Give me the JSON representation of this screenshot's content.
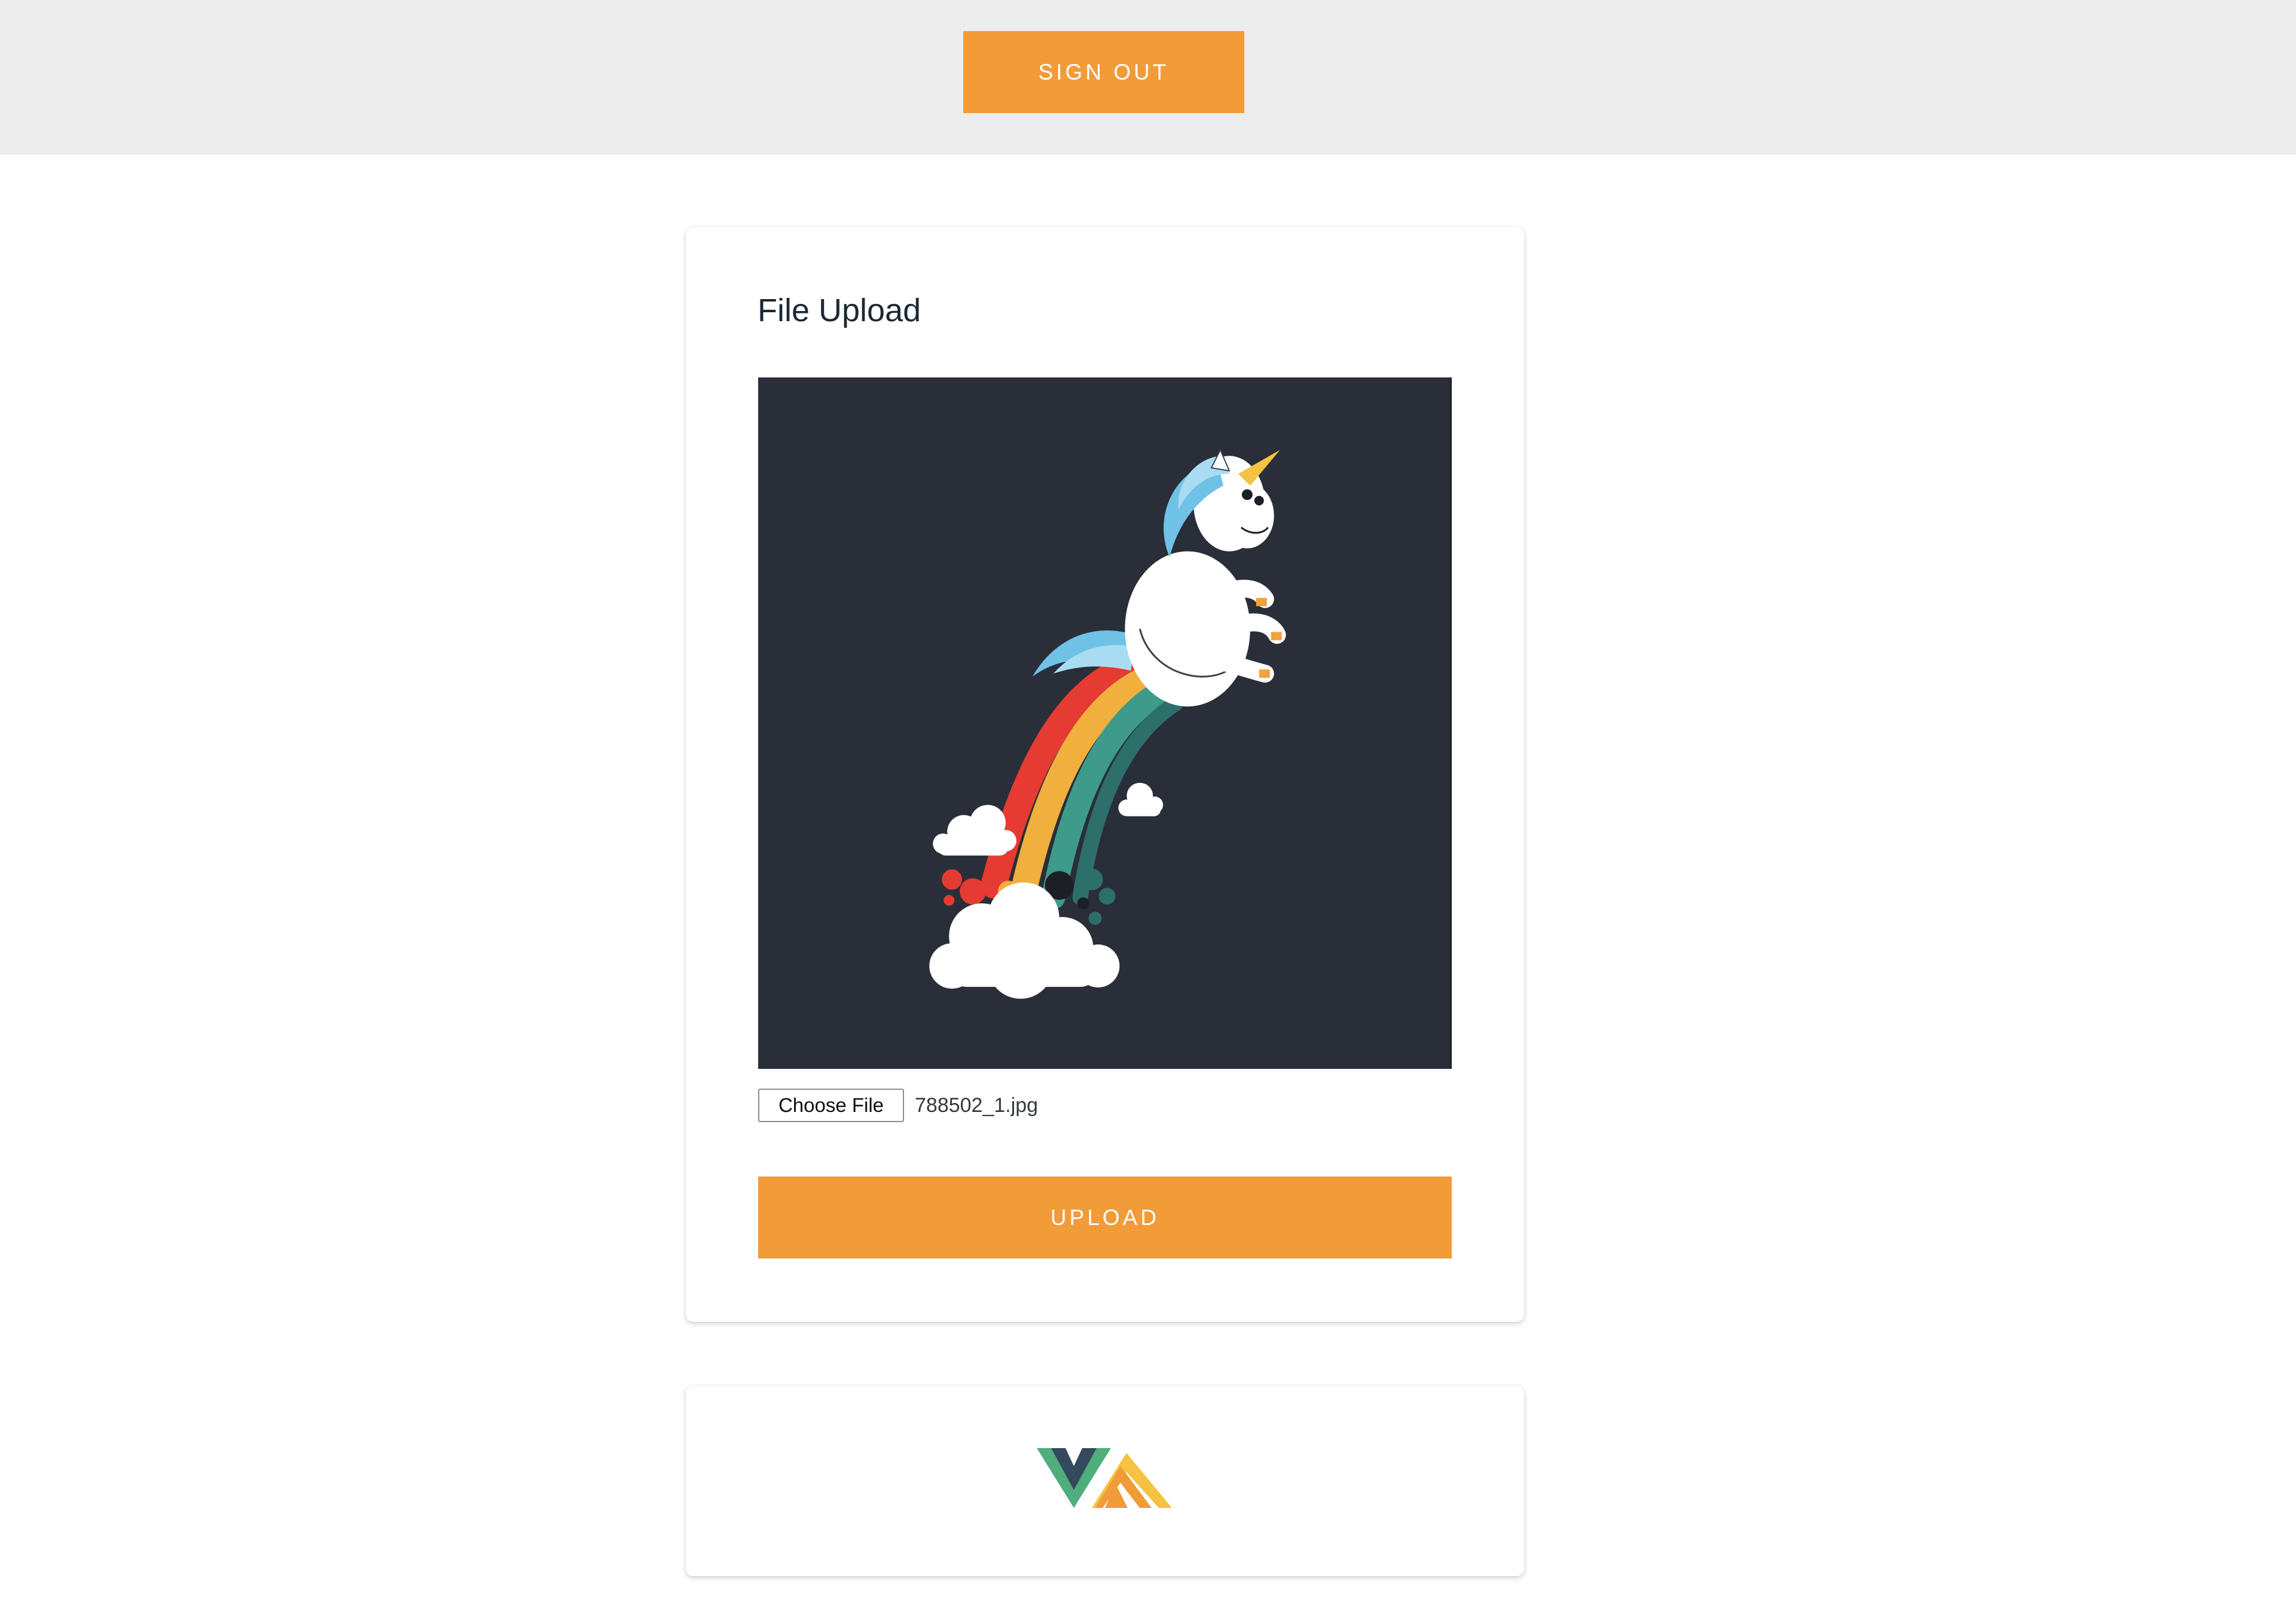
{
  "header": {
    "sign_out_label": "SIGN OUT"
  },
  "upload_card": {
    "title": "File Upload",
    "preview_image": "unicorn-rainbow-illustration",
    "choose_file_label": "Choose File",
    "selected_file_name": "788502_1.jpg",
    "upload_label": "UPLOAD"
  },
  "footer_card": {
    "logo": "vue-amplify-logo"
  },
  "colors": {
    "accent": "#f19b39",
    "topbar_bg": "#ededed",
    "preview_bg": "#2a2e38"
  }
}
